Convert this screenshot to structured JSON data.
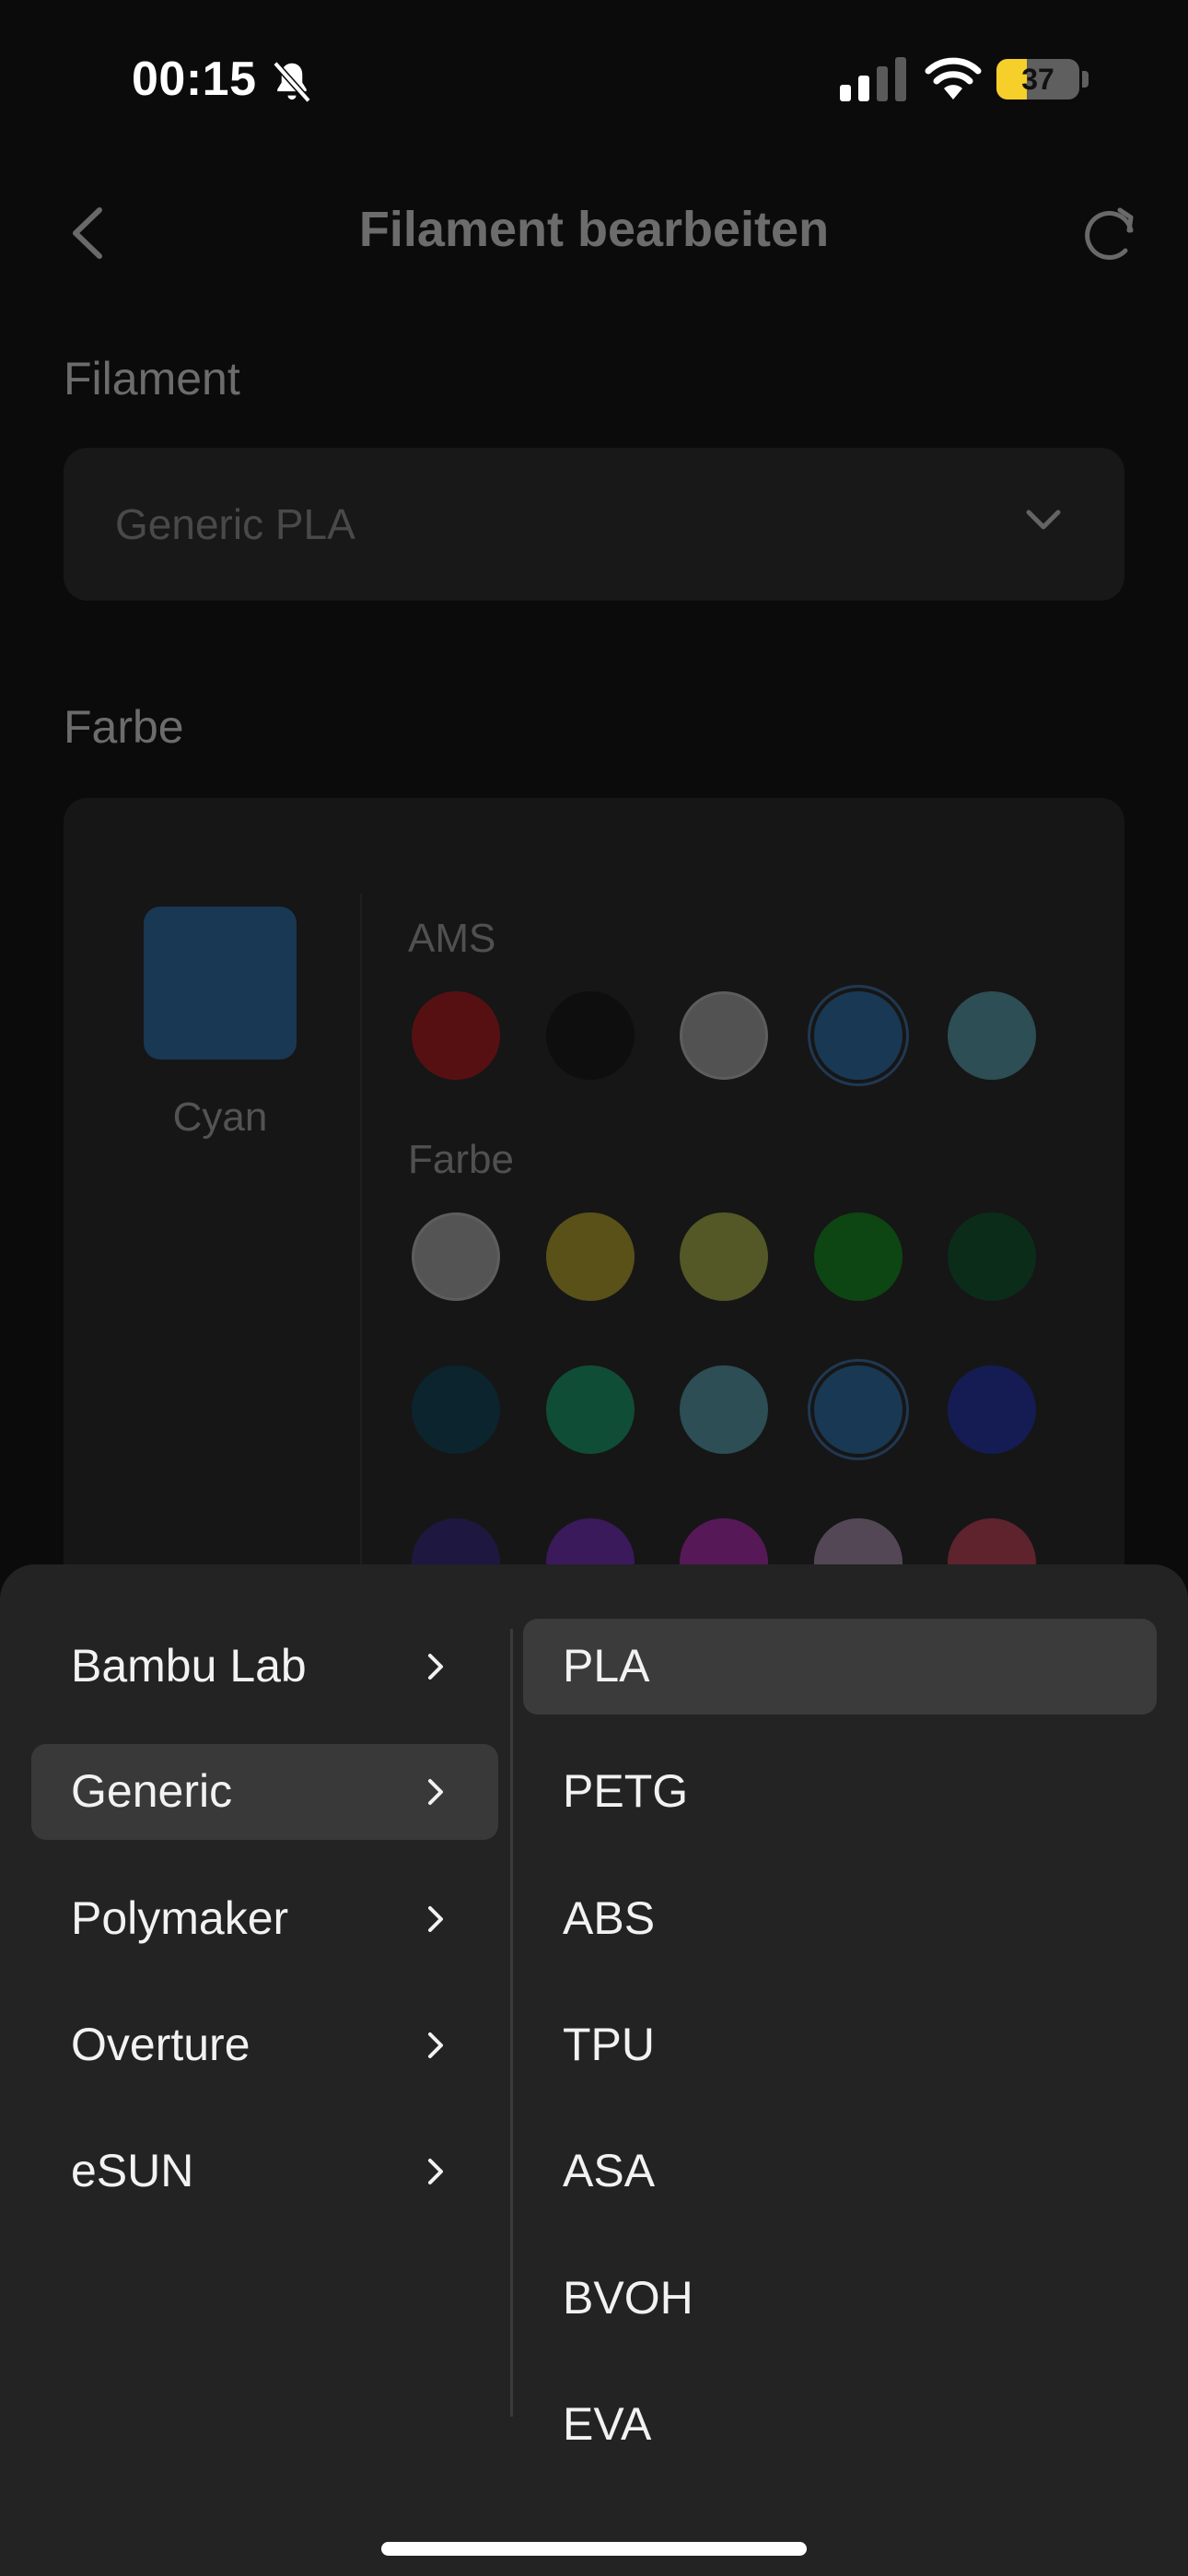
{
  "status_bar": {
    "time": "00:15",
    "battery_level": "37",
    "battery_fraction": 0.37,
    "icons": [
      "bell-slash-icon",
      "signal-icon",
      "wifi-icon",
      "battery-icon"
    ]
  },
  "header": {
    "title": "Filament bearbeiten",
    "back_icon": "chevron-left-icon",
    "refresh_icon": "refresh-icon"
  },
  "filament_section": {
    "label": "Filament",
    "selected_value": "Generic PLA",
    "dropdown_icon": "chevron-down-icon"
  },
  "color_section": {
    "label": "Farbe",
    "selected_color_name": "Cyan",
    "selected_color_hex": "#2e76b6",
    "ams_label": "AMS",
    "ams_colors": [
      {
        "hex": "#c1171d",
        "outlined": false,
        "selected": false
      },
      {
        "hex": "#141414",
        "outlined": false,
        "selected": false
      },
      {
        "hex": "#b5b5b5",
        "outlined": true,
        "selected": false
      },
      {
        "hex": "#2e76b6",
        "outlined": false,
        "selected": true
      },
      {
        "hex": "#5aaab9",
        "outlined": false,
        "selected": false
      }
    ],
    "palette_label": "Farbe",
    "palette_rows": [
      [
        {
          "hex": "#b9b9b9",
          "outlined": true,
          "selected": false
        },
        {
          "hex": "#c6b12a",
          "outlined": false,
          "selected": false
        },
        {
          "hex": "#b6c34d",
          "outlined": false,
          "selected": false
        },
        {
          "hex": "#12951f",
          "outlined": false,
          "selected": false
        },
        {
          "hex": "#0b5a2e",
          "outlined": false,
          "selected": false
        }
      ],
      [
        {
          "hex": "#0c4860",
          "outlined": false,
          "selected": false
        },
        {
          "hex": "#17a873",
          "outlined": false,
          "selected": false
        },
        {
          "hex": "#5aaab9",
          "outlined": false,
          "selected": false
        },
        {
          "hex": "#2e76b6",
          "outlined": false,
          "selected": true
        },
        {
          "hex": "#2235b8",
          "outlined": false,
          "selected": false
        }
      ],
      [
        {
          "hex": "#3a2a8a",
          "outlined": false,
          "selected": false
        },
        {
          "hex": "#7b2fc8",
          "outlined": false,
          "selected": false
        },
        {
          "hex": "#c02ac2",
          "outlined": false,
          "selected": false
        },
        {
          "hex": "#b79abd",
          "outlined": false,
          "selected": false
        },
        {
          "hex": "#d0465a",
          "outlined": false,
          "selected": false
        }
      ]
    ]
  },
  "picker_sheet": {
    "brands": [
      {
        "label": "Bambu Lab",
        "active": false
      },
      {
        "label": "Generic",
        "active": true
      },
      {
        "label": "Polymaker",
        "active": false
      },
      {
        "label": "Overture",
        "active": false
      },
      {
        "label": "eSUN",
        "active": false
      }
    ],
    "types": [
      {
        "label": "PLA",
        "active": true
      },
      {
        "label": "PETG",
        "active": false
      },
      {
        "label": "ABS",
        "active": false
      },
      {
        "label": "TPU",
        "active": false
      },
      {
        "label": "ASA",
        "active": false
      },
      {
        "label": "BVOH",
        "active": false
      },
      {
        "label": "EVA",
        "active": false
      }
    ]
  }
}
